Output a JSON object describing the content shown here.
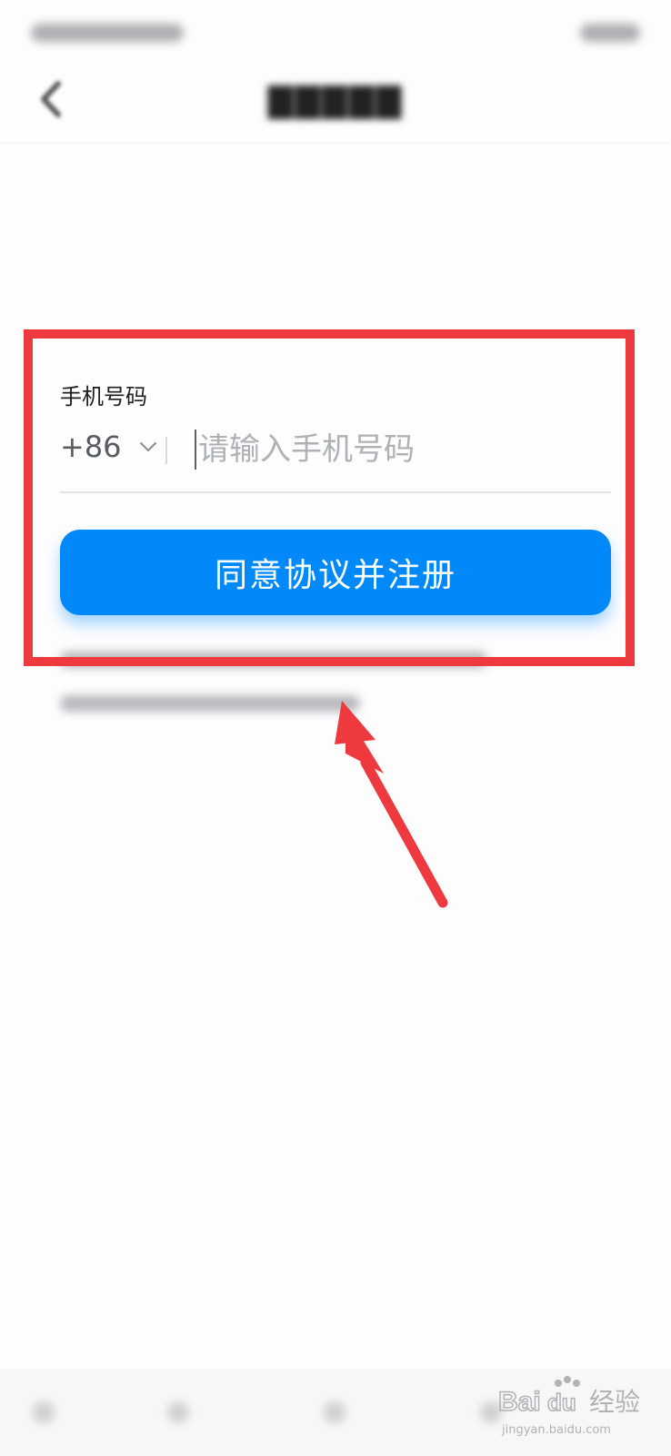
{
  "phone_field": {
    "label": "手机号码",
    "country_code": "+86",
    "placeholder": "请输入手机号码",
    "value": ""
  },
  "register_button": {
    "label": "同意协议并注册"
  },
  "watermark": {
    "brand": "Bai",
    "brand_suffix": "du",
    "product": "经验",
    "url": "jingyan.baidu.com"
  },
  "colors": {
    "primary": "#0289f9",
    "annotation": "#ee3a3f"
  },
  "icons": {
    "back": "back-chevron-icon",
    "country_dropdown": "chevron-down-icon",
    "arrow": "red-arrow-annotation"
  }
}
